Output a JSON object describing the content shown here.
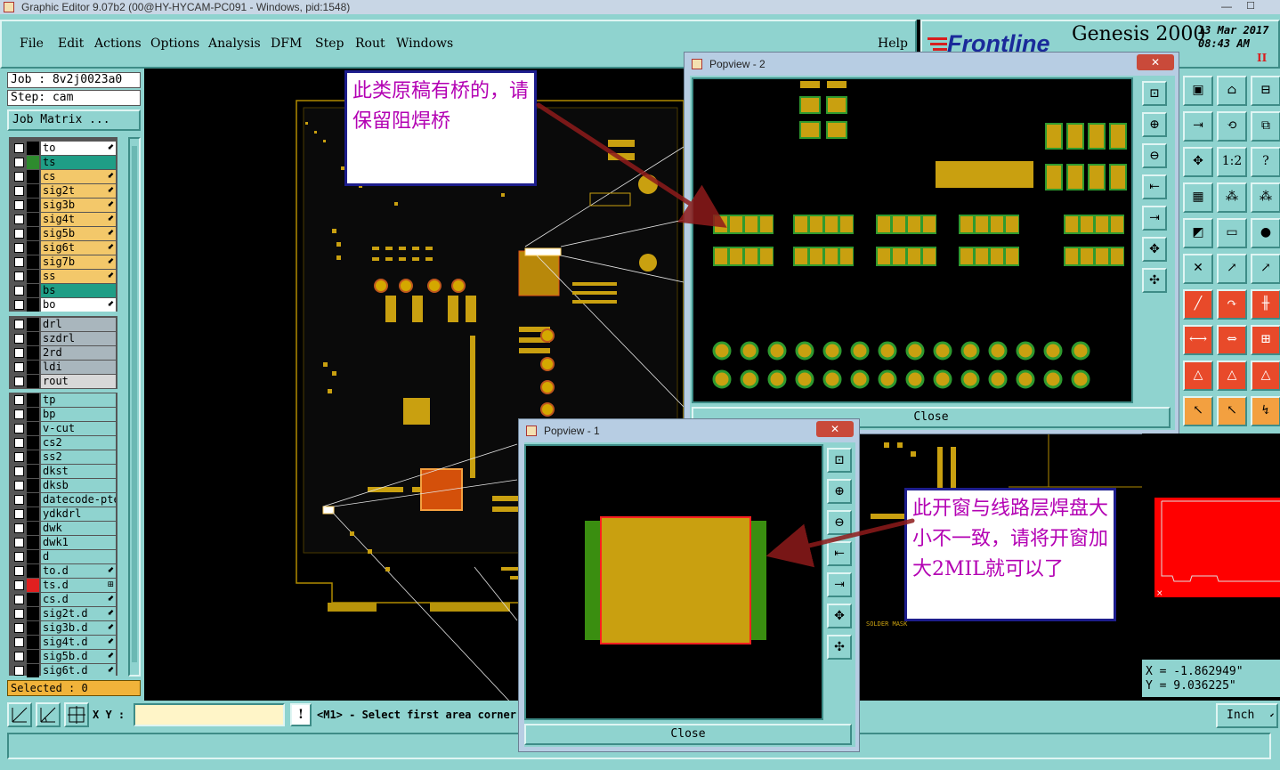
{
  "window": {
    "title": "Graphic Editor 9.07b2 (00@HY-HYCAM-PC091 - Windows, pid:1548)",
    "minimize_glyph": "—",
    "maximize_glyph": "☐"
  },
  "menu": {
    "items": [
      "File",
      "Edit",
      "Actions",
      "Options",
      "Analysis",
      "DFM",
      "Step",
      "Rout",
      "Windows"
    ],
    "help": "Help"
  },
  "brand": {
    "logo": "Frontline",
    "product": "Genesis 2000",
    "date": "13 Mar 2017",
    "time": "08:43 AM",
    "indicator": "II",
    "accent_color": "#d81e1e"
  },
  "job": {
    "job_label": "Job : 8v2j0023a0",
    "step_label": "Step: cam",
    "matrix_button": "Job Matrix ..."
  },
  "layers": {
    "group1": [
      {
        "name": "to",
        "color": "#ffffff",
        "swatch": "",
        "arrow": "⬋"
      },
      {
        "name": "ts",
        "color": "#1f9e86",
        "swatch": "#2e8b2e",
        "arrow": ""
      },
      {
        "name": "cs",
        "color": "#f3c86a",
        "swatch": "",
        "arrow": "⬋"
      },
      {
        "name": "sig2t",
        "color": "#f3c86a",
        "swatch": "",
        "arrow": "⬋"
      },
      {
        "name": "sig3b",
        "color": "#f3c86a",
        "swatch": "",
        "arrow": "⬋"
      },
      {
        "name": "sig4t",
        "color": "#f3c86a",
        "swatch": "",
        "arrow": "⬋"
      },
      {
        "name": "sig5b",
        "color": "#f3c86a",
        "swatch": "",
        "arrow": "⬋"
      },
      {
        "name": "sig6t",
        "color": "#f3c86a",
        "swatch": "",
        "arrow": "⬋"
      },
      {
        "name": "sig7b",
        "color": "#f3c86a",
        "swatch": "",
        "arrow": "⬋"
      },
      {
        "name": "ss",
        "color": "#f3c86a",
        "swatch": "",
        "arrow": "⬋"
      },
      {
        "name": "bs",
        "color": "#1f9e86",
        "swatch": "",
        "arrow": ""
      },
      {
        "name": "bo",
        "color": "#ffffff",
        "swatch": "",
        "arrow": "⬋"
      }
    ],
    "group2": [
      {
        "name": "drl",
        "color": "#a9b6bd"
      },
      {
        "name": "szdrl",
        "color": "#a9b6bd"
      },
      {
        "name": "2rd",
        "color": "#a9b6bd"
      },
      {
        "name": "ldi",
        "color": "#a9b6bd"
      },
      {
        "name": "rout",
        "color": "#d8d8d8"
      }
    ],
    "group3": [
      {
        "name": "tp",
        "color": "#8fd3cf",
        "swatch": "",
        "arrow": ""
      },
      {
        "name": "bp",
        "color": "#8fd3cf",
        "swatch": "",
        "arrow": ""
      },
      {
        "name": "v-cut",
        "color": "#8fd3cf",
        "swatch": "",
        "arrow": ""
      },
      {
        "name": "cs2",
        "color": "#8fd3cf",
        "swatch": "",
        "arrow": ""
      },
      {
        "name": "ss2",
        "color": "#8fd3cf",
        "swatch": "",
        "arrow": ""
      },
      {
        "name": "dkst",
        "color": "#8fd3cf",
        "swatch": "",
        "arrow": ""
      },
      {
        "name": "dksb",
        "color": "#8fd3cf",
        "swatch": "",
        "arrow": ""
      },
      {
        "name": "datecode-pte",
        "color": "#8fd3cf",
        "swatch": "",
        "arrow": ""
      },
      {
        "name": "ydkdrl",
        "color": "#8fd3cf",
        "swatch": "",
        "arrow": ""
      },
      {
        "name": "dwk",
        "color": "#8fd3cf",
        "swatch": "",
        "arrow": ""
      },
      {
        "name": "dwk1",
        "color": "#8fd3cf",
        "swatch": "",
        "arrow": ""
      },
      {
        "name": "d",
        "color": "#8fd3cf",
        "swatch": "",
        "arrow": ""
      },
      {
        "name": "to.d",
        "color": "#8fd3cf",
        "swatch": "",
        "arrow": "⬋"
      },
      {
        "name": "ts.d",
        "color": "#8fd3cf",
        "swatch": "#e02020",
        "arrow": "⊞"
      },
      {
        "name": "cs.d",
        "color": "#8fd3cf",
        "swatch": "",
        "arrow": "⬋"
      },
      {
        "name": "sig2t.d",
        "color": "#8fd3cf",
        "swatch": "",
        "arrow": "⬋"
      },
      {
        "name": "sig3b.d",
        "color": "#8fd3cf",
        "swatch": "",
        "arrow": "⬋"
      },
      {
        "name": "sig4t.d",
        "color": "#8fd3cf",
        "swatch": "",
        "arrow": "⬋"
      },
      {
        "name": "sig5b.d",
        "color": "#8fd3cf",
        "swatch": "",
        "arrow": "⬋"
      },
      {
        "name": "sig6t.d",
        "color": "#8fd3cf",
        "swatch": "",
        "arrow": "⬋"
      }
    ],
    "selected_label": "Selected : 0"
  },
  "popview2": {
    "title": "Popview - 2",
    "close_glyph": "✕",
    "close_button": "Close",
    "tools": [
      "⊡",
      "⊕",
      "⊖",
      "⇤",
      "⇥",
      "✥",
      "✣"
    ]
  },
  "popview1": {
    "title": "Popview - 1",
    "close_glyph": "✕",
    "close_button": "Close",
    "tools": [
      "⊡",
      "⊕",
      "⊖",
      "⇤",
      "⇥",
      "✥",
      "✣"
    ]
  },
  "annotations": {
    "note1": "此类原稿有桥的，请保留阻焊桥",
    "note2": "此开窗与线路层焊盘大小不一致，请将开窗加大2MIL就可以了"
  },
  "canvas_text": {
    "solder_mask_label": "SOLDER MASK"
  },
  "right_tools": [
    "▣",
    "⌂",
    "⊟",
    "⇥",
    "⟲",
    "⧉",
    "✥",
    "1:2",
    "?",
    "▦",
    "⁂",
    "⁂",
    "◩",
    "▭",
    "●",
    "✕",
    "↗",
    "↗",
    "╱",
    "↷",
    "╫",
    "⟷",
    "⇔",
    "⊞",
    "△",
    "△",
    "△",
    "↖",
    "↖",
    "↯"
  ],
  "coordinates": {
    "x": "X  = -1.862949\"",
    "y": "Y  = 9.036225\""
  },
  "bottom": {
    "xy_label": "X Y :",
    "xy_value": "",
    "warn_glyph": "!",
    "status": "<M1> - Select first area corner",
    "units": "Inch",
    "units_arrow": "⬋"
  }
}
